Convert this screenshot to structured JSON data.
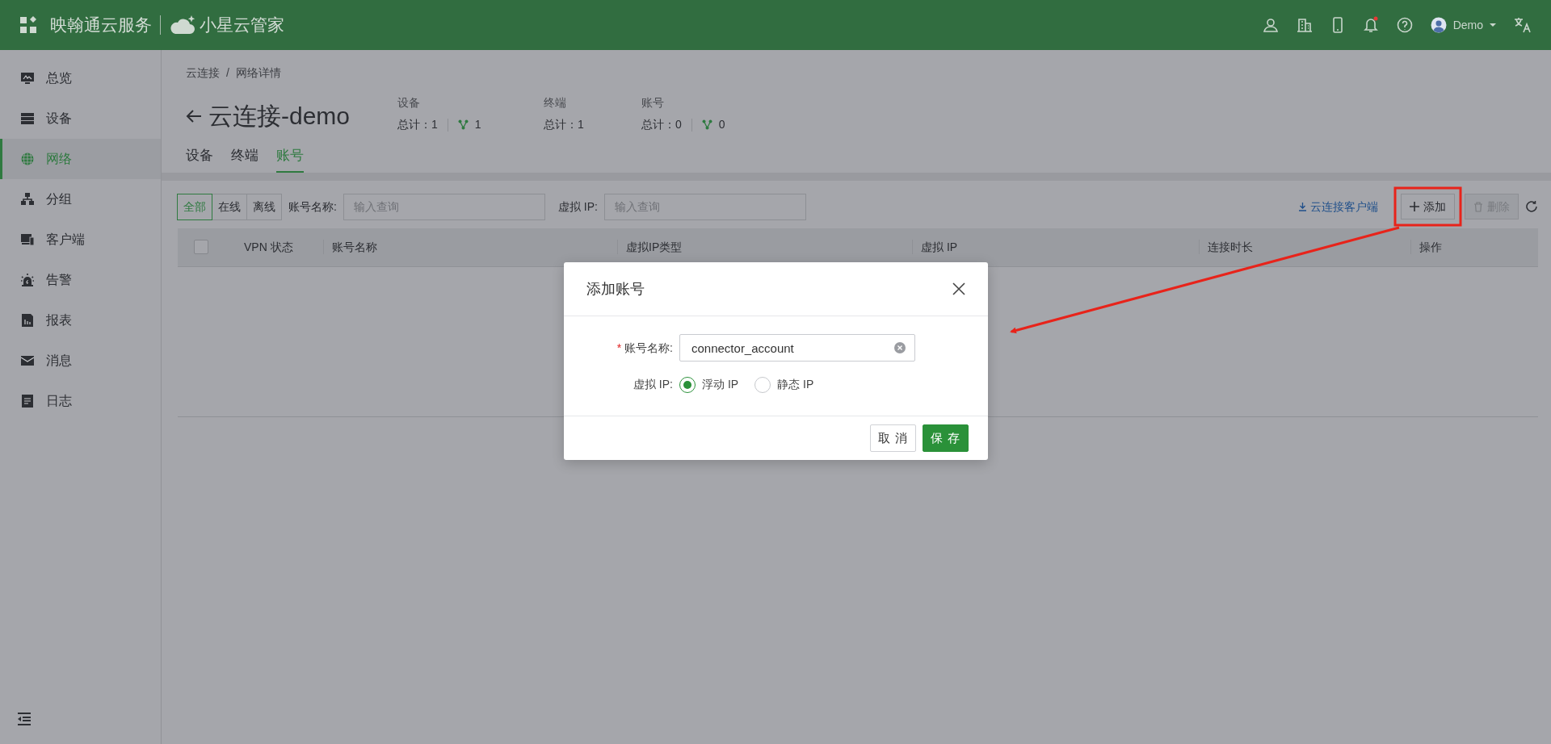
{
  "header": {
    "brand": "映翰通云服务",
    "product": "小星云管家",
    "user": "Demo",
    "bell_alert": true
  },
  "sidebar": {
    "items": [
      {
        "label": "总览",
        "selected": false
      },
      {
        "label": "设备",
        "selected": false
      },
      {
        "label": "网络",
        "selected": true
      },
      {
        "label": "分组",
        "selected": false
      },
      {
        "label": "客户端",
        "selected": false
      },
      {
        "label": "告警",
        "selected": false
      },
      {
        "label": "报表",
        "selected": false
      },
      {
        "label": "消息",
        "selected": false
      },
      {
        "label": "日志",
        "selected": false
      }
    ]
  },
  "breadcrumb": {
    "items": [
      "云连接",
      "网络详情"
    ],
    "separator": "/"
  },
  "title": "云连接-demo",
  "stats": [
    {
      "label": "设备",
      "total": "总计：1",
      "online": "1"
    },
    {
      "label": "终端",
      "total": "总计：1"
    },
    {
      "label": "账号",
      "total": "总计：0",
      "online": "0"
    }
  ],
  "tabs": [
    {
      "label": "设备",
      "selected": false
    },
    {
      "label": "终端",
      "selected": false
    },
    {
      "label": "账号",
      "selected": true
    }
  ],
  "filters": {
    "status": [
      {
        "label": "全部",
        "selected": true
      },
      {
        "label": "在线",
        "selected": false
      },
      {
        "label": "离线",
        "selected": false
      }
    ],
    "name_label": "账号名称:",
    "name_placeholder": "输入查询",
    "ip_label": "虚拟 IP:",
    "ip_placeholder": "输入查询"
  },
  "actions": {
    "download": "云连接客户端",
    "add": "添加",
    "delete": "删除",
    "delete_disabled": true
  },
  "table": {
    "select_all_checked": false,
    "columns": [
      "VPN 状态",
      "账号名称",
      "虚拟IP类型",
      "虚拟 IP",
      "连接时长",
      "操作"
    ]
  },
  "dialog": {
    "title": "添加账号",
    "required_mark": "*",
    "name_label": "账号名称:",
    "name_value": "connector_account",
    "ip_label": "虚拟 IP:",
    "ip_options": [
      {
        "label": "浮动 IP",
        "selected": true
      },
      {
        "label": "静态 IP",
        "selected": false
      }
    ],
    "buttons": [
      {
        "label": "取 消",
        "kind": "default"
      },
      {
        "label": "保 存",
        "kind": "primary"
      }
    ]
  }
}
